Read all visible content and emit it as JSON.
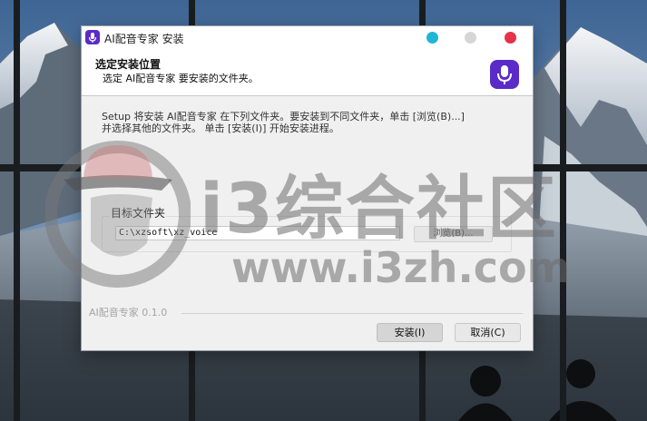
{
  "window": {
    "title": "AI配音专家 安装",
    "header_title": "选定安装位置",
    "header_subtitle": "选定 AI配音专家 要安装的文件夹。",
    "description_line1": "Setup 将安装 AI配音专家 在下列文件夹。要安装到不同文件夹，单击 [浏览(B)...]",
    "description_line2": "并选择其他的文件夹。 单击 [安装(I)] 开始安装进程。",
    "group_label": "目标文件夹",
    "path_value": "C:\\xzsoft\\xz_voice",
    "browse_label": "浏览(B)...",
    "footer_brand": "AI配音专家 0.1.0",
    "install_label": "安装(I)",
    "cancel_label": "取消(C)"
  },
  "watermark": {
    "text_big": "i3综合社区",
    "text_url": "www.i3zh.com"
  },
  "colors": {
    "accent": "#5a2bc8",
    "minimize": "#1fb6d6",
    "maximize": "#d6d6d6",
    "close": "#e6314a"
  },
  "icons": {
    "app": "microphone-icon",
    "header_logo": "microphone-icon",
    "watermark_logo": "hat-face-icon"
  }
}
